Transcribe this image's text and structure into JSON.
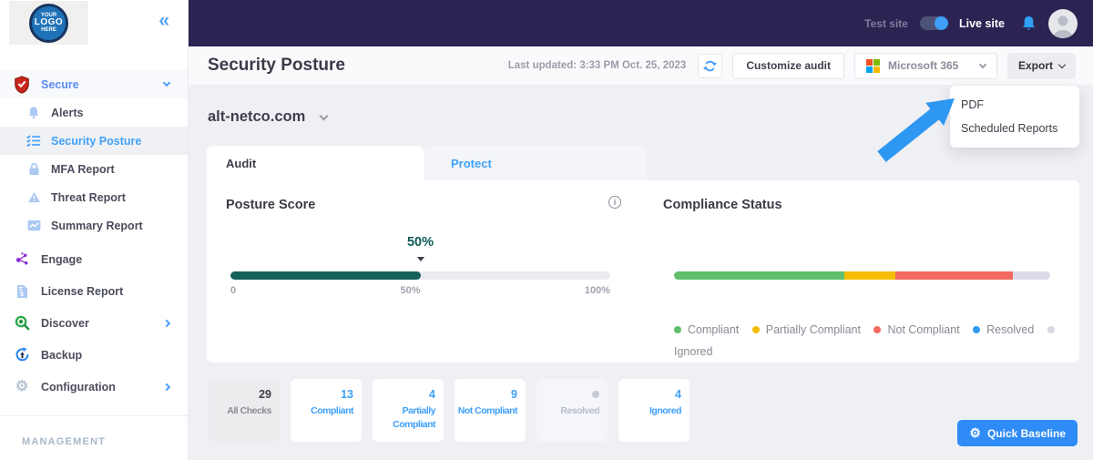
{
  "sidebar": {
    "logo": {
      "line1": "YOUR",
      "line2": "LOGO",
      "line3": "HERE"
    },
    "items": [
      {
        "label": "Secure",
        "icon": "shield-icon",
        "expanded": true
      },
      {
        "label": "Alerts",
        "icon": "bell-icon"
      },
      {
        "label": "Security Posture",
        "icon": "checklist-icon",
        "selected": true
      },
      {
        "label": "MFA Report",
        "icon": "lock-icon"
      },
      {
        "label": "Threat Report",
        "icon": "warning-icon"
      },
      {
        "label": "Summary Report",
        "icon": "chart-icon"
      },
      {
        "label": "Engage",
        "icon": "network-icon"
      },
      {
        "label": "License Report",
        "icon": "invoice-icon"
      },
      {
        "label": "Discover",
        "icon": "magnifier-icon",
        "has_children": true
      },
      {
        "label": "Backup",
        "icon": "backup-icon"
      },
      {
        "label": "Configuration",
        "icon": "gear-icon",
        "has_children": true
      }
    ],
    "section_label": "MANAGEMENT"
  },
  "topbar": {
    "test_site_label": "Test site",
    "live_site_label": "Live site",
    "toggle_state": "on"
  },
  "header": {
    "title": "Security Posture",
    "last_updated": "Last updated: 3:33 PM Oct. 25, 2023",
    "customize_audit_label": "Customize audit",
    "tenant_selector_value": "Microsoft 365",
    "export_label": "Export"
  },
  "export_menu": {
    "items": [
      {
        "label": "PDF"
      },
      {
        "label": "Scheduled Reports"
      }
    ]
  },
  "main": {
    "tenant_domain": "alt-netco.com",
    "tabs": [
      {
        "label": "Audit",
        "active": true
      },
      {
        "label": "Protect",
        "active": false
      }
    ],
    "posture": {
      "title": "Posture Score",
      "score_label": "50%",
      "score_pct": 50,
      "scale": [
        "0",
        "50%",
        "100%"
      ],
      "bar_color": "#15615c"
    },
    "compliance": {
      "title": "Compliance Status",
      "segments": [
        {
          "name": "Compliant",
          "pct": 45.3,
          "color": "#5fbf6c"
        },
        {
          "name": "Partially Compliant",
          "pct": 13.6,
          "color": "#f5bd00"
        },
        {
          "name": "Not Compliant",
          "pct": 31.2,
          "color": "#f2695f"
        },
        {
          "name": "Ignored",
          "pct": 9.9,
          "color": "#dcdbe8"
        }
      ],
      "legend": [
        {
          "label": "Compliant",
          "color": "#5fbf6c"
        },
        {
          "label": "Partially Compliant",
          "color": "#f5bd00"
        },
        {
          "label": "Not Compliant",
          "color": "#f2695f"
        },
        {
          "label": "Resolved",
          "color": "#2e9af0"
        },
        {
          "label": "Ignored",
          "color": "#d9d9e3"
        }
      ]
    }
  },
  "stats": [
    {
      "value": "29",
      "label": "All Checks"
    },
    {
      "value": "13",
      "label": "Compliant"
    },
    {
      "value": "4",
      "label": "Partially Compliant"
    },
    {
      "value": "9",
      "label": "Not Compliant"
    },
    {
      "value": "",
      "label": "Resolved"
    },
    {
      "value": "4",
      "label": "Ignored"
    }
  ],
  "quick_baseline_label": "Quick Baseline"
}
